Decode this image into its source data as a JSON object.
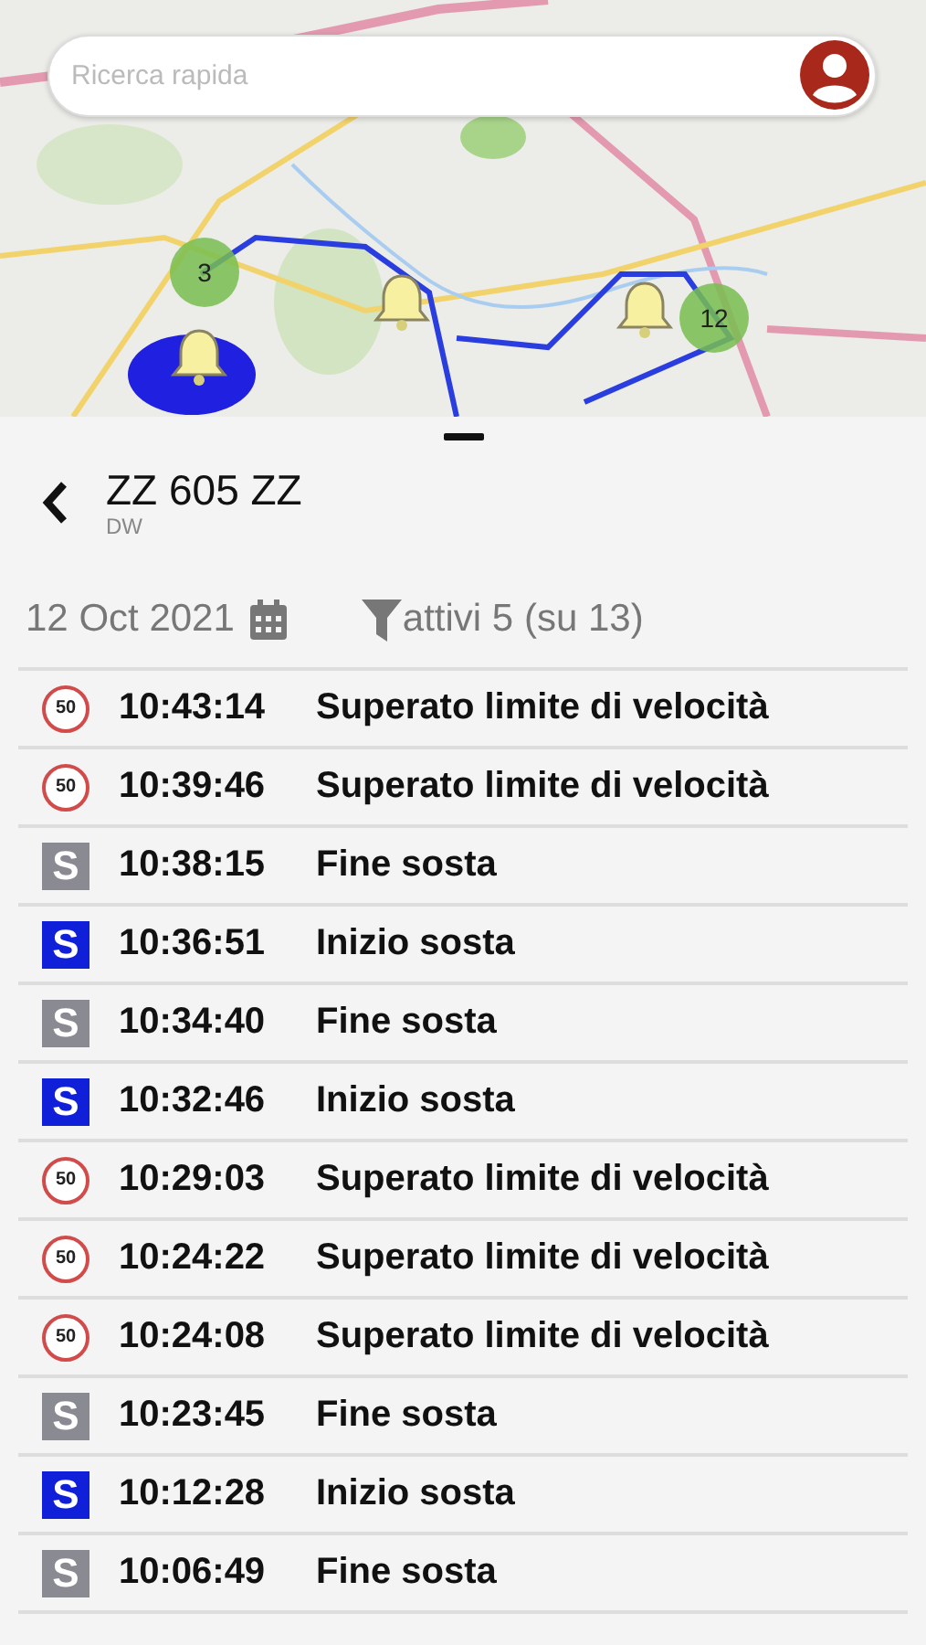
{
  "search": {
    "placeholder": "Ricerca rapida"
  },
  "map": {
    "kind": "picture",
    "clusters": [
      {
        "count": "3"
      },
      {
        "count": "12"
      }
    ]
  },
  "vehicle": {
    "plate": "ZZ 605 ZZ",
    "subtitle": "DW"
  },
  "filters": {
    "date": "12 Oct 2021",
    "filter": "attivi 5 (su 13)"
  },
  "events": [
    {
      "kind": "speed",
      "badge": "50",
      "time": "10:43:14",
      "text": "Superato limite di velocità"
    },
    {
      "kind": "speed",
      "badge": "50",
      "time": "10:39:46",
      "text": "Superato limite di velocità"
    },
    {
      "kind": "stop_end",
      "badge": "S",
      "time": "10:38:15",
      "text": "Fine sosta"
    },
    {
      "kind": "stop_start",
      "badge": "S",
      "time": "10:36:51",
      "text": "Inizio sosta"
    },
    {
      "kind": "stop_end",
      "badge": "S",
      "time": "10:34:40",
      "text": "Fine sosta"
    },
    {
      "kind": "stop_start",
      "badge": "S",
      "time": "10:32:46",
      "text": "Inizio sosta"
    },
    {
      "kind": "speed",
      "badge": "50",
      "time": "10:29:03",
      "text": "Superato limite di velocità"
    },
    {
      "kind": "speed",
      "badge": "50",
      "time": "10:24:22",
      "text": "Superato limite di velocità"
    },
    {
      "kind": "speed",
      "badge": "50",
      "time": "10:24:08",
      "text": "Superato limite di velocità"
    },
    {
      "kind": "stop_end",
      "badge": "S",
      "time": "10:23:45",
      "text": "Fine sosta"
    },
    {
      "kind": "stop_start",
      "badge": "S",
      "time": "10:12:28",
      "text": "Inizio sosta"
    },
    {
      "kind": "stop_end",
      "badge": "S",
      "time": "10:06:49",
      "text": "Fine sosta"
    }
  ]
}
